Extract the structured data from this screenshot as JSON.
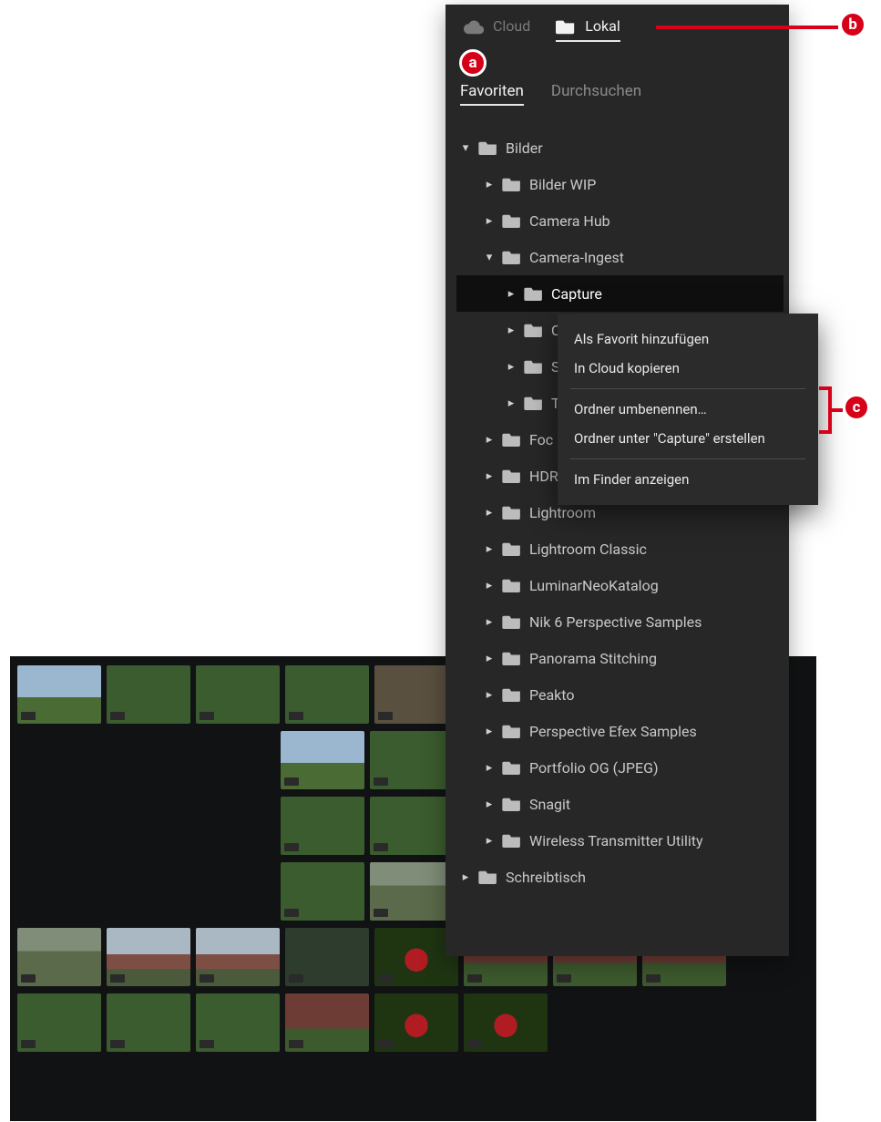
{
  "tabs": {
    "cloud": "Cloud",
    "lokal": "Lokal"
  },
  "subtabs": {
    "favoriten": "Favoriten",
    "durchsuchen": "Durchsuchen"
  },
  "tree": {
    "root1": {
      "label": "Bilder",
      "depth": 0,
      "open": true
    },
    "bilder_wip": {
      "label": "Bilder WIP",
      "depth": 1,
      "open": false
    },
    "camera_hub": {
      "label": "Camera Hub",
      "depth": 1,
      "open": false
    },
    "camera_ingest": {
      "label": "Camera-Ingest",
      "depth": 1,
      "open": true
    },
    "capture": {
      "label": "Capture",
      "depth": 2,
      "open": false,
      "selected": true
    },
    "sub2": {
      "label": "C",
      "depth": 2,
      "open": false
    },
    "sub3": {
      "label": "S",
      "depth": 2,
      "open": false
    },
    "sub4": {
      "label": "T",
      "depth": 2,
      "open": false
    },
    "foc": {
      "label": "Foc",
      "depth": 1,
      "open": false
    },
    "hdr": {
      "label": "HDR Merge",
      "depth": 1,
      "open": false
    },
    "lr": {
      "label": "Lightroom",
      "depth": 1,
      "open": false
    },
    "lrc": {
      "label": "Lightroom Classic",
      "depth": 1,
      "open": false
    },
    "lumin": {
      "label": "LuminarNeoKatalog",
      "depth": 1,
      "open": false
    },
    "nik": {
      "label": "Nik 6 Perspective Samples",
      "depth": 1,
      "open": false
    },
    "pano": {
      "label": "Panorama Stitching",
      "depth": 1,
      "open": false
    },
    "peakto": {
      "label": "Peakto",
      "depth": 1,
      "open": false
    },
    "persp": {
      "label": "Perspective Efex Samples",
      "depth": 1,
      "open": false
    },
    "portf": {
      "label": "Portfolio OG (JPEG)",
      "depth": 1,
      "open": false
    },
    "snag": {
      "label": "Snagit",
      "depth": 1,
      "open": false
    },
    "wtu": {
      "label": "Wireless Transmitter Utility",
      "depth": 1,
      "open": false
    },
    "root2": {
      "label": "Schreibtisch",
      "depth": 0,
      "open": false
    }
  },
  "context_menu": {
    "add_favorite": "Als Favorit hinzufügen",
    "copy_cloud": "In Cloud kopieren",
    "rename": "Ordner umbenennen…",
    "create_under": "Ordner unter \"Capture\" erstellen",
    "show_finder": "Im Finder anzeigen"
  },
  "callouts": {
    "a": "a",
    "b": "b",
    "c": "c"
  }
}
